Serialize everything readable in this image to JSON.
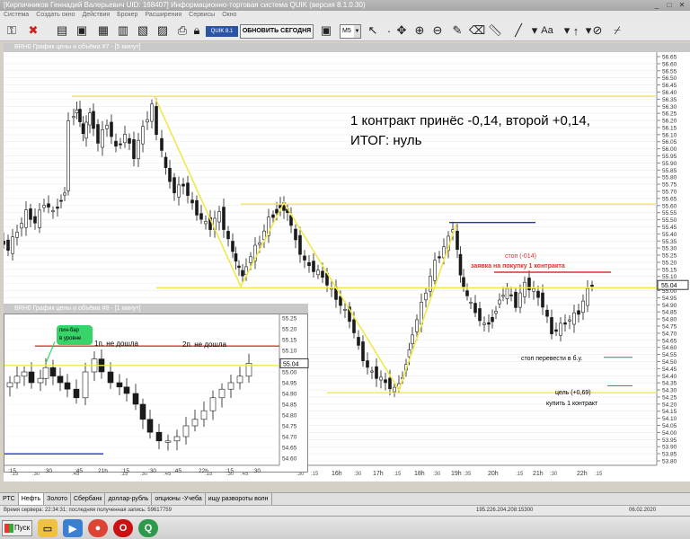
{
  "window": {
    "title": "[Кирпичников Геннадий Валерьевич UID: 168407] Информационно-торговая система QUIK (версия 8.1.0.30)"
  },
  "menu": [
    "Система",
    "Создать окно",
    "Действия",
    "Брокер",
    "Расширения",
    "Сервисы",
    "Окно"
  ],
  "toolbar": {
    "quik_badge": "QUIK 8.1",
    "update_button": "ОБНОВИТЬ СЕГОДНЯ",
    "timeframe": "M5",
    "text_tool": "Aa"
  },
  "main_chart": {
    "window_title": "BRH0 График цены и объёма #7 - [5 минут]",
    "price_axis": [
      "56.65",
      "56.60",
      "56.55",
      "56.50",
      "56.45",
      "56.40",
      "56.35",
      "56.30",
      "56.25",
      "56.20",
      "56.15",
      "56.10",
      "56.05",
      "56.00",
      "55.95",
      "55.90",
      "55.85",
      "55.80",
      "55.75",
      "55.70",
      "55.65",
      "55.60",
      "55.55",
      "55.50",
      "55.45",
      "55.40",
      "55.35",
      "55.30",
      "55.25",
      "55.20",
      "55.15",
      "55.10",
      "55.05",
      "55.00",
      "54.95",
      "54.90",
      "54.85",
      "54.80",
      "54.75",
      "54.70",
      "54.65",
      "54.60",
      "54.55",
      "54.50",
      "54.45",
      "54.40",
      "54.35",
      "54.30",
      "54.25",
      "54.20",
      "54.15",
      "54.10",
      "54.05",
      "54.00",
      "53.95",
      "53.90",
      "53.85",
      "53.80"
    ],
    "last_price": "55.04",
    "time_axis": [
      "16h",
      "17h",
      "18h",
      "19h",
      "20h",
      "21h",
      "22h"
    ],
    "time_axis_minor": [
      ":15",
      ":30",
      ":45",
      ":15",
      ":30",
      ":45",
      ":15",
      ":30",
      ":45",
      ":35",
      ":15",
      ":30",
      ":15",
      ":30",
      ":15",
      ":30",
      ":15",
      ":30"
    ],
    "headline_line1": "1 контракт принёс -0,14, второй +0,14,",
    "headline_line2": "ИТОГ: нуль",
    "label_stop": "стоп  (-014)",
    "label_order": "заявка на покупку 1 контракта",
    "label_move_stop": "стоп перевести в б.у.",
    "label_target": "цель  (+0,69)",
    "label_buy": "купить 1 контракт",
    "colors": {
      "yellow": "#f0e84a",
      "red": "#e03030",
      "blue": "#2030d0",
      "candle": "#1a1a1a"
    }
  },
  "inset_chart": {
    "window_title": "BRH0 График цены и объёма #8 - [1 минут]",
    "price_axis": [
      "55.25",
      "55.20",
      "55.15",
      "55.10",
      "55.05",
      "55.00",
      "54.95",
      "54.90",
      "54.85",
      "54.80",
      "54.75",
      "54.70",
      "54.65",
      "54.60"
    ],
    "last_price": "55.04",
    "time_axis": [
      ":15",
      ":30",
      ":45",
      "21h",
      ":15",
      ":30",
      ":45",
      "22h",
      ":15",
      ":30"
    ],
    "label_pinbar_line1": "пин-бар",
    "label_pinbar_line2": "в уровне",
    "label_first": "1п. не дошла",
    "label_second": "2п. не дошла"
  },
  "bottom_tabs": [
    "РТС",
    "Нефть",
    "Золото",
    "Сбербанк",
    "доллар-рубль",
    "опционы -Учеба",
    "ищу развороты волн"
  ],
  "status": {
    "server_time": "Время сервера: 22:34:31; последняя полученная запись: 59617759",
    "connection": "195.226.204.208:15300",
    "date": "06.02.2020"
  },
  "taskbar": {
    "start_label": "Пуск"
  }
}
